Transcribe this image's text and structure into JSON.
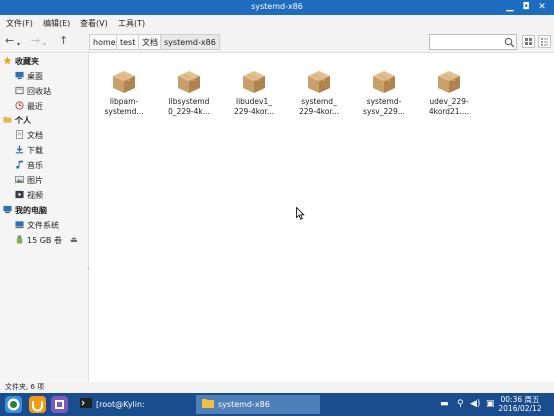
{
  "window": {
    "title": "systemd-x86",
    "min_glyph": "▁",
    "max_glyph": "◘",
    "close_glyph": "✕"
  },
  "menu": [
    "文件(F)",
    "编辑(E)",
    "查看(V)",
    "工具(T)"
  ],
  "breadcrumb": [
    "home",
    "test",
    "文档",
    "systemd-x86"
  ],
  "search": {
    "placeholder": "",
    "value": ""
  },
  "sidebar": {
    "favorites": {
      "title": "收藏夹",
      "items": [
        {
          "label": "桌面",
          "icon": "desktop-icon"
        },
        {
          "label": "回收站",
          "icon": "trash-icon"
        },
        {
          "label": "最近",
          "icon": "recent-icon"
        }
      ]
    },
    "personal": {
      "title": "个人",
      "items": [
        {
          "label": "文档",
          "icon": "document-icon"
        },
        {
          "label": "下载",
          "icon": "download-icon"
        },
        {
          "label": "音乐",
          "icon": "music-icon"
        },
        {
          "label": "图片",
          "icon": "picture-icon"
        },
        {
          "label": "视频",
          "icon": "video-icon"
        }
      ]
    },
    "computer": {
      "title": "我的电脑",
      "items": [
        {
          "label": "文件系统",
          "icon": "filesystem-icon"
        },
        {
          "label": "15 GB 卷",
          "icon": "usb-drive-icon"
        }
      ]
    }
  },
  "files": [
    {
      "name_line1": "libpam-",
      "name_line2": "systemd..."
    },
    {
      "name_line1": "libsystemd",
      "name_line2": "0_229-4k..."
    },
    {
      "name_line1": "libudev1_",
      "name_line2": "229-4kor..."
    },
    {
      "name_line1": "systemd_",
      "name_line2": "229-4kor..."
    },
    {
      "name_line1": "systemd-",
      "name_line2": "sysv_229..."
    },
    {
      "name_line1": "udev_229-",
      "name_line2": "4kord21...."
    }
  ],
  "status": {
    "text": "文件夹, 6 项"
  },
  "taskbar": {
    "tasks": [
      {
        "label": "[root@Kylin: /home/tes...",
        "icon": "terminal-icon"
      },
      {
        "label": "systemd-x86",
        "icon": "folder-icon"
      }
    ],
    "clock": {
      "time": "00:36 周五",
      "date": "2016/02/12"
    }
  },
  "colors": {
    "titlebar": "#1e6cbf",
    "taskbar": "#194d8d",
    "package_box": "#c9a06a"
  }
}
